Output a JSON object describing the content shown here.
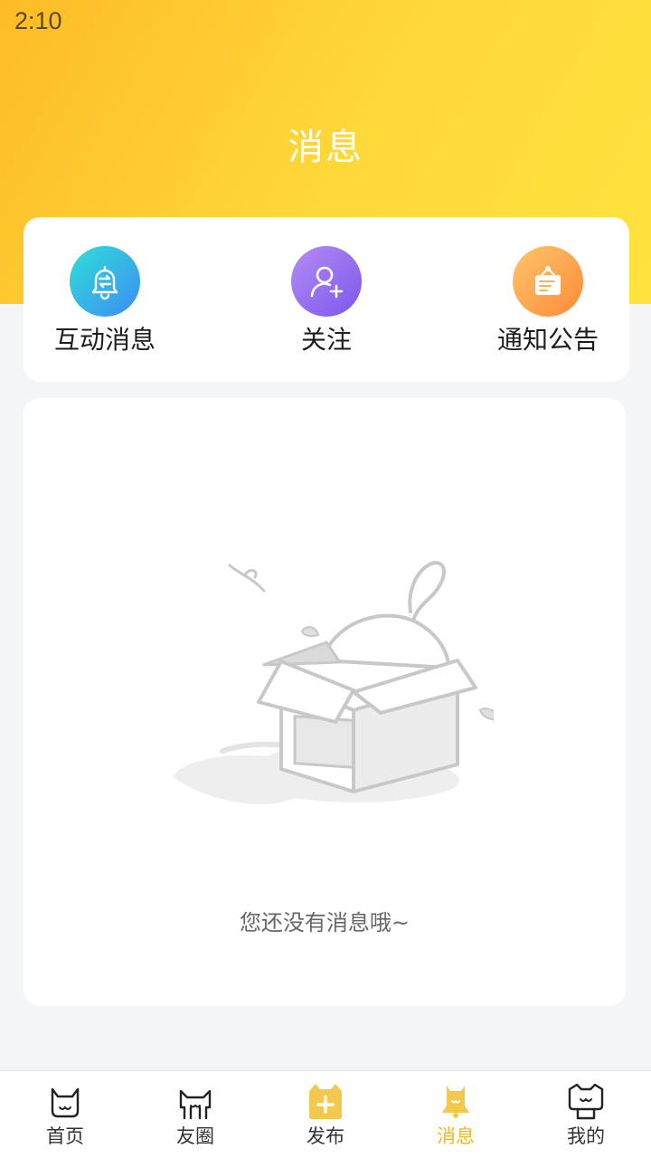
{
  "status_bar": {
    "time": "2:10"
  },
  "header": {
    "title": "消息"
  },
  "quick_actions": [
    {
      "label": "互动消息",
      "icon": "bell-exchange-icon",
      "color": "#3f8bf5"
    },
    {
      "label": "关注",
      "icon": "add-user-icon",
      "color": "#7b57ea"
    },
    {
      "label": "通知公告",
      "icon": "notice-board-icon",
      "color": "#ff8a3a"
    }
  ],
  "empty_state": {
    "text": "您还没有消息哦~"
  },
  "tabbar": {
    "active_color": "#f2b81f",
    "items": [
      {
        "label": "首页",
        "icon": "cat-home-icon"
      },
      {
        "label": "友圈",
        "icon": "cat-circle-icon"
      },
      {
        "label": "发布",
        "icon": "cat-publish-icon"
      },
      {
        "label": "消息",
        "icon": "cat-bell-icon",
        "active": true
      },
      {
        "label": "我的",
        "icon": "cat-profile-icon"
      }
    ]
  }
}
